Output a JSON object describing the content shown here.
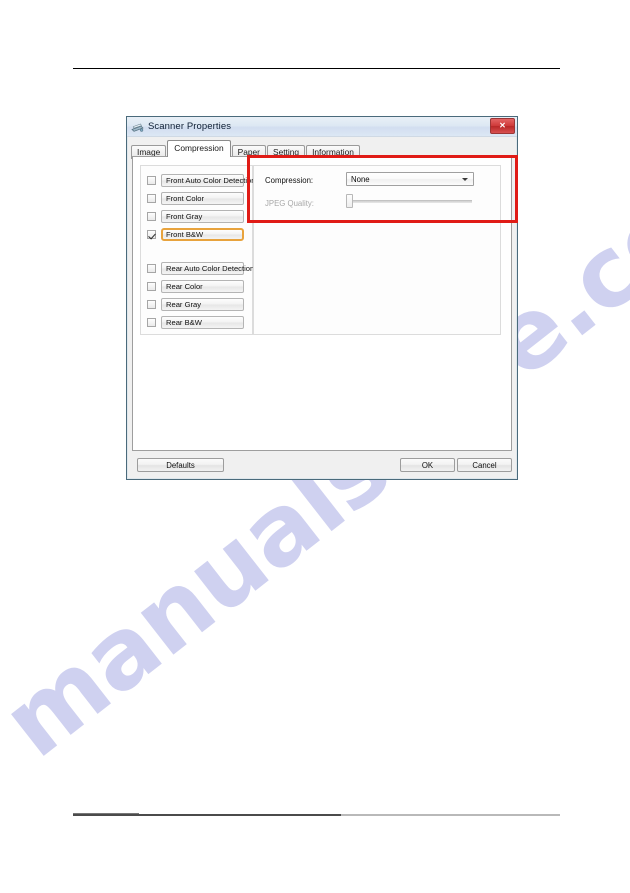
{
  "page": {
    "watermark": "manualshive.com"
  },
  "dialog": {
    "title": "Scanner Properties",
    "title_icon": "scanner-icon",
    "close_label": "✕",
    "tabs": [
      {
        "label": "Image",
        "active": false
      },
      {
        "label": "Compression",
        "active": true
      },
      {
        "label": "Paper",
        "active": false
      },
      {
        "label": "Setting",
        "active": false
      },
      {
        "label": "Information",
        "active": false
      }
    ],
    "channels": [
      {
        "label": "Front Auto Color Detection",
        "checked": false,
        "focused": false
      },
      {
        "label": "Front Color",
        "checked": false,
        "focused": false
      },
      {
        "label": "Front Gray",
        "checked": false,
        "focused": false
      },
      {
        "label": "Front B&W",
        "checked": true,
        "focused": true
      },
      {
        "label": "Rear Auto Color Detection",
        "checked": false,
        "focused": false
      },
      {
        "label": "Rear Color",
        "checked": false,
        "focused": false
      },
      {
        "label": "Rear Gray",
        "checked": false,
        "focused": false
      },
      {
        "label": "Rear B&W",
        "checked": false,
        "focused": false
      }
    ],
    "compression": {
      "label": "Compression:",
      "value": "None",
      "options": [
        "None"
      ]
    },
    "jpeg_quality": {
      "label": "JPEG Quality:",
      "enabled": false,
      "value": 0
    },
    "buttons": {
      "defaults": "Defaults",
      "ok": "OK",
      "cancel": "Cancel"
    },
    "colors": {
      "annotation": "#e01b16",
      "focus": "#e8a33d",
      "close": "#cf3b3b",
      "watermark": "#c9cbee"
    }
  }
}
